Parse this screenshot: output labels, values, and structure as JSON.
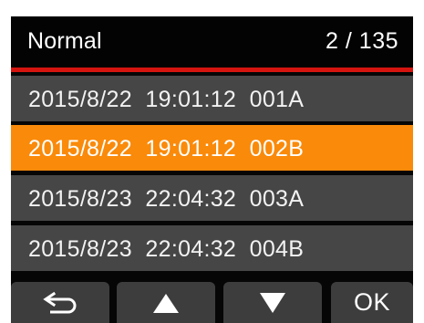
{
  "header": {
    "title": "Normal",
    "counter": "2 / 135"
  },
  "files": [
    {
      "text": "2015/8/22  19:01:12  001A",
      "selected": false
    },
    {
      "text": "2015/8/22  19:01:12  002B",
      "selected": true
    },
    {
      "text": "2015/8/23  22:04:32  003A",
      "selected": false
    },
    {
      "text": "2015/8/23  22:04:32  004B",
      "selected": false
    }
  ],
  "toolbar": {
    "back_icon": "return-arrow-icon",
    "up_icon": "triangle-up-icon",
    "down_icon": "triangle-down-icon",
    "ok_label": "OK"
  },
  "colors": {
    "background": "#060606",
    "header": "#030303",
    "accent_line": "#d6140f",
    "row": "#464646",
    "selected_row": "#fa8a0a",
    "button": "#3d3d3d",
    "text": "#ffffff"
  }
}
